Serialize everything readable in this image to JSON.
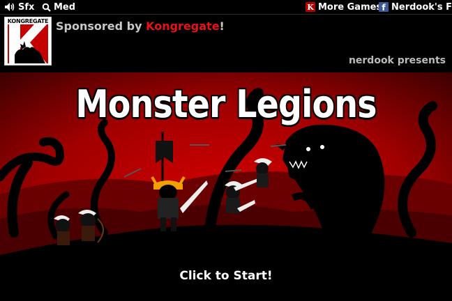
{
  "topbar": {
    "sfx_label": "Sfx",
    "quality_label": "Med",
    "more_games_label": "More Games!",
    "facebook_label": "Nerdook's FB"
  },
  "logo": {
    "text": "KONGREGATE"
  },
  "sponsor": {
    "prefix": "Sponsored by ",
    "brand": "Kongregate",
    "suffix": "!"
  },
  "presents": "nerdook presents",
  "game_title": "Monster Legions",
  "start_label": "Click to Start!",
  "colors": {
    "brand_red": "#e8101a",
    "scene_red": "#b40000",
    "dark_red": "#5a0000",
    "silhouette": "#000000"
  },
  "icons": [
    "speaker-icon",
    "magnifier-icon",
    "kongregate-k-icon",
    "facebook-icon"
  ]
}
